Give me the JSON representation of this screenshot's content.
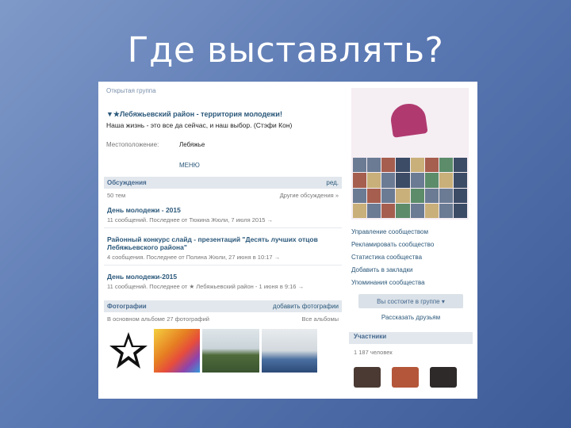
{
  "slide": {
    "title": "Где выставлять?"
  },
  "page": {
    "group_type": "Открытая группа",
    "group_title": "▼★Лебяжьевский район - территория молодежи!",
    "group_status": "Наша жизнь - это все да сейчас, и наш выбор. (Стэфи Кон)",
    "info": {
      "location_key": "Местоположение:",
      "location_value": "Лебяжье"
    },
    "menu_label": "МЕНЮ",
    "discussions": {
      "header": "Обсуждения",
      "edit": "ред.",
      "count": "50 тем",
      "all": "Другие обсуждения »",
      "topics": [
        {
          "title": "День молодежи - 2015",
          "meta": "11 сообщений. Последнее от Тюкина Жюли, 7 июля 2015 →"
        },
        {
          "title": "Районный конкурс слайд - презентаций \"Десять лучших отцов Лебяжьевского района\"",
          "meta": "4 сообщения. Последнее от Полина Жюли, 27 июня в 10:17 →"
        },
        {
          "title": "День молодежи-2015",
          "meta": "11 сообщений. Последнее от ★ Лебяжьевский район - 1 июня в 9:16 →"
        }
      ]
    },
    "photos": {
      "header": "Фотографии",
      "add": "добавить фотографии",
      "album": "В основном альбоме 27 фотографий",
      "all": "Все альбомы"
    },
    "right_links": [
      "Управление сообществом",
      "Рекламировать сообщество",
      "Статистика сообщества",
      "Добавить в закладки",
      "Упоминания сообщества"
    ],
    "membership_button": "Вы состоите в группе ▾",
    "tell_friends": "Рассказать друзьям",
    "members": {
      "header": "Участники",
      "count": "1 187 человек"
    }
  },
  "colors": {
    "link": "#2b587a",
    "block_header": "#e1e7ed",
    "slide_bg": "#5a78b2"
  }
}
